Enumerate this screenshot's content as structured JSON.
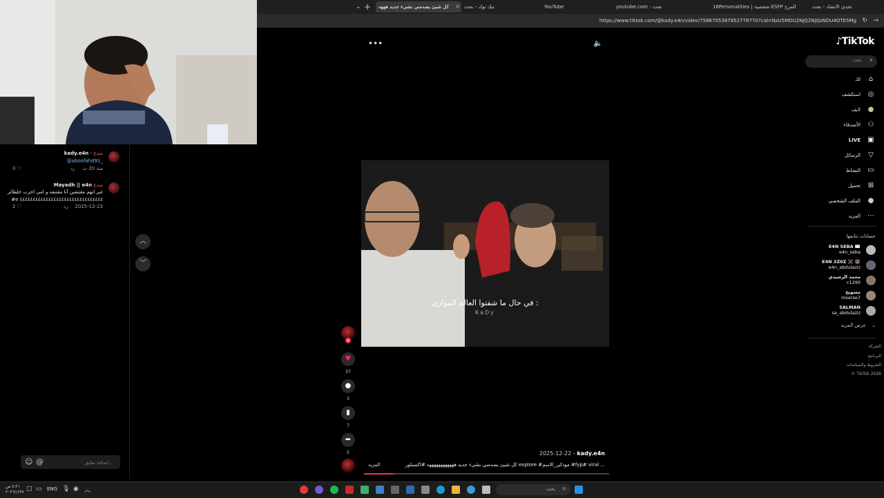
{
  "browser": {
    "tabs": [
      {
        "label": "كل شيئ يصدمني بشيء جديد هههه",
        "active": true
      },
      {
        "label": "تيك توك - بحث",
        "active": false
      },
      {
        "label": "YouTube",
        "active": false
      },
      {
        "label": "youtube.com - بحث",
        "active": false
      },
      {
        "label": "16Personalities | شخصية ESFP المرح",
        "active": false
      },
      {
        "label": "تحدي الانشاد - بحث",
        "active": false
      }
    ],
    "url": "https://www.tiktok.com/@kady.e4n/video/7586705387852778770?cid=NzU5MDU2NjQ2NjQzNDU4OTE5Mg"
  },
  "comments": [
    {
      "name": "kady.e4n",
      "badge": "مبدع",
      "text": "@aboofahd91_",
      "time": "منذ 20 ث",
      "reply": "رد",
      "likes": "0"
    },
    {
      "name": "Mayadh || e4n",
      "badge": "مبدع",
      "text": "غير انهم مقتنعين أنا مقتنعه و امي احرب خلطاتر",
      "text2": "#e ٤٤٤٤٤٤٤٤٤٤٤٤٤٤٤٤٤٤٤٤٤٤٤٤٤٤٤٤٤٤٤٤",
      "time": "2025-12-23",
      "reply": "رد",
      "likes": "2"
    }
  ],
  "comment_input": {
    "placeholder": "إضافة تعليق...",
    "at": "@"
  },
  "video": {
    "caption": "في حال ما شفتوا العالم الموازي :",
    "watermark": "KaDy",
    "author": "kady.e4n",
    "date": "2025-12-22",
    "description": "كل شيئ يصدمني بشيء جديد ههههههههههههه #اكسبلور explore #مودكي_الاسم #fyp# viral ...",
    "more": "المزيد",
    "likes": "37",
    "comments": "3",
    "saves": "7",
    "shares": "5"
  },
  "sidebar": {
    "logo": "TikTok",
    "search_placeholder": "بحث",
    "nav": [
      {
        "label": "لك",
        "icon": "home-icon"
      },
      {
        "label": "استكشف",
        "icon": "compass-icon"
      },
      {
        "label": "لايف",
        "icon": "avatar-icon"
      },
      {
        "label": "الأصدقاء",
        "icon": "people-icon"
      },
      {
        "label": "LIVE",
        "icon": "live-icon"
      },
      {
        "label": "الرسائل",
        "icon": "send-icon"
      },
      {
        "label": "النشاط",
        "icon": "message-icon"
      },
      {
        "label": "تحميل",
        "icon": "plus-icon"
      },
      {
        "label": "الملف الشخصي",
        "icon": "profile-icon"
      },
      {
        "label": "المزيد",
        "icon": "more-icon"
      }
    ],
    "following_title": "حسابات تتابعها",
    "following": [
      {
        "name": "E4N SEBA ✉️",
        "handle": "e4n_seba"
      },
      {
        "name": "E4N 3Z0Z ✖️ 🐻",
        "handle": "e4n_abdulaziz"
      },
      {
        "name": "محمد الرشيدي",
        "handle": "c1290"
      },
      {
        "name": "مسويح",
        "handle": "msarse7"
      },
      {
        "name": "SALMAN",
        "handle": "sa_abdulaziz"
      }
    ],
    "see_more": "عرض المزيد",
    "footer": [
      "الشركة",
      "البرنامج",
      "الشروط والسياسات",
      "© TikTok 2026"
    ]
  },
  "taskbar": {
    "search_placeholder": "بحث",
    "lang": "ENG",
    "time": "٤:٢١ ص",
    "date": "٢٠٢٦/١/٢٧"
  }
}
